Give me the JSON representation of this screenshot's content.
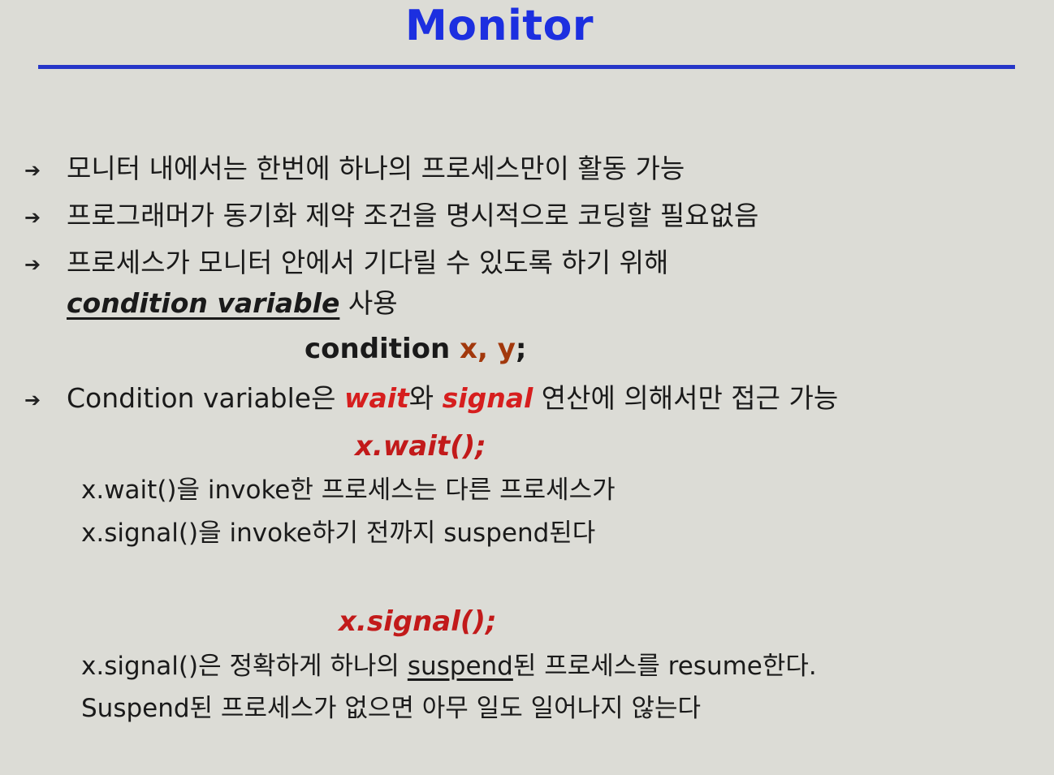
{
  "slide": {
    "title": "Monitor"
  },
  "bullets": {
    "b1": "모니터 내에서는 한번에 하나의 프로세스만이 활동 가능",
    "b2": "프로그래머가 동기화 제약 조건을 명시적으로 코딩할 필요없음",
    "b3_line1": "프로세스가 모니터 안에서 기다릴 수 있도록 하기 위해",
    "b3_em": "condition variable",
    "b3_tail": " 사용",
    "b4_prefix": "Condition variable은 ",
    "b4_wait": "wait",
    "b4_mid": "와 ",
    "b4_signal": "signal",
    "b4_tail": " 연산에 의해서만 접근 가능"
  },
  "code": {
    "decl_keyword": "condition ",
    "decl_vars": "x, y",
    "decl_end": ";",
    "wait_call": "x.wait();",
    "signal_call": "x.signal();"
  },
  "wait_desc": {
    "line1": "x.wait()을 invoke한 프로세스는 다른 프로세스가",
    "line2": "x.signal()을 invoke하기 전까지 suspend된다"
  },
  "signal_desc": {
    "line1_a": "x.signal()은 정확하게 하나의 ",
    "line1_u": "suspend",
    "line1_b": "된 프로세스를 resume한다.",
    "line2": "Suspend된 프로세스가 없으면 아무 일도 일어나지 않는다"
  },
  "colors": {
    "title": "#1c2fe0",
    "rule": "#2636c8",
    "emphasis_red": "#d61e1e",
    "vars_brown": "#a2380c",
    "background": "#dcdcd6"
  },
  "icons": {
    "bullet": "arrow-bullet-icon"
  }
}
